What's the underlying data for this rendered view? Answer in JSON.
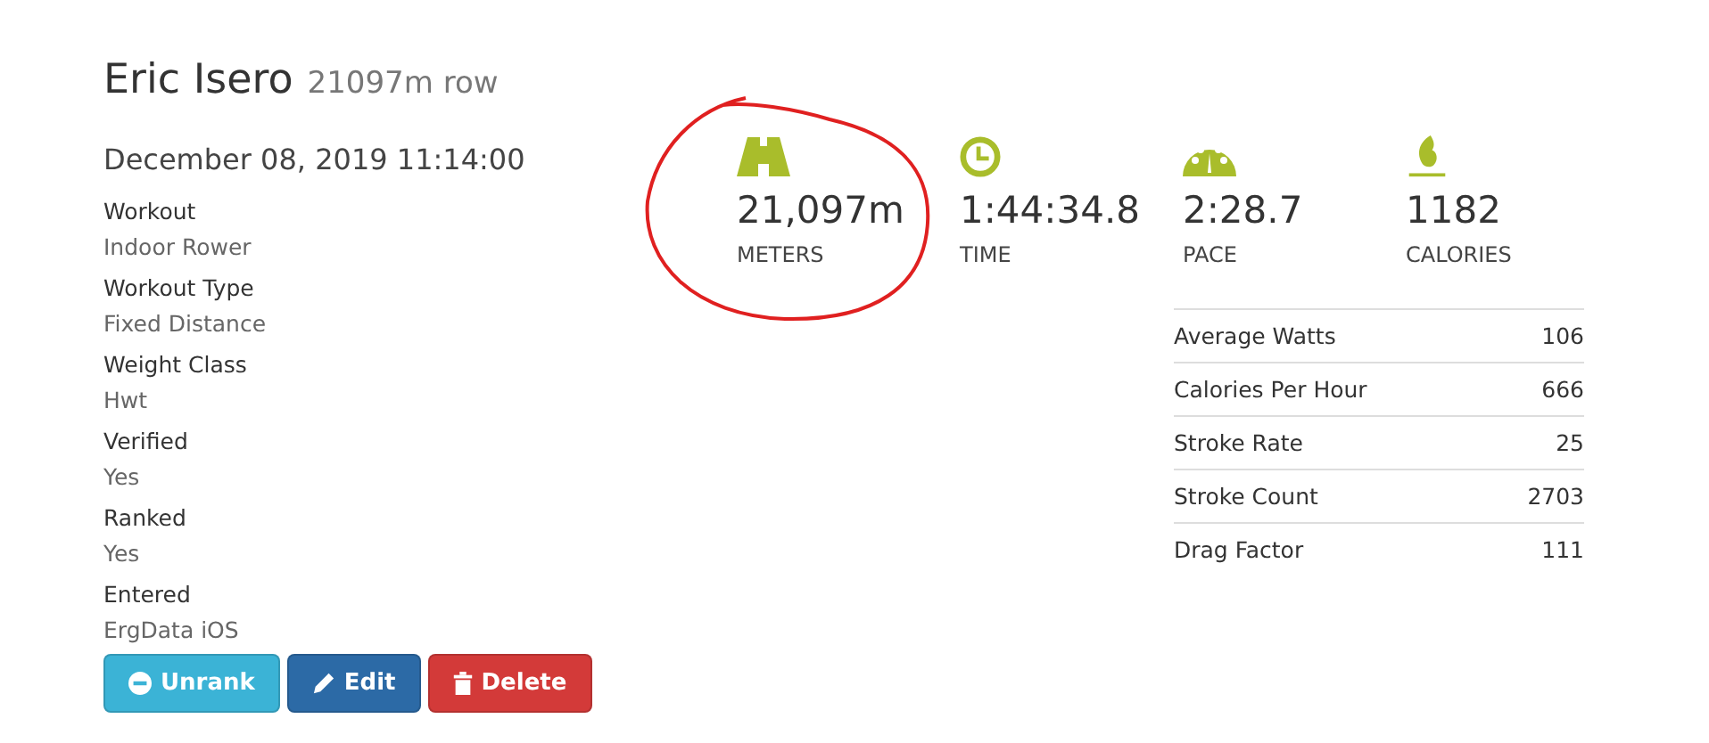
{
  "header": {
    "name": "Eric Isero",
    "subtitle": "21097m row"
  },
  "date": "December 08, 2019 11:14:00",
  "details": [
    {
      "label": "Workout",
      "value": "Indoor Rower"
    },
    {
      "label": "Workout Type",
      "value": "Fixed Distance"
    },
    {
      "label": "Weight Class",
      "value": "Hwt"
    },
    {
      "label": "Verified",
      "value": "Yes"
    },
    {
      "label": "Ranked",
      "value": "Yes"
    },
    {
      "label": "Entered",
      "value": "ErgData iOS"
    }
  ],
  "buttons": [
    {
      "kind": "unrank",
      "label": "Unrank"
    },
    {
      "kind": "edit",
      "label": "Edit"
    },
    {
      "kind": "delete",
      "label": "Delete"
    }
  ],
  "stats": [
    {
      "kind": "distance",
      "value": "21,097m",
      "label": "METERS",
      "circled": true
    },
    {
      "kind": "time",
      "value": "1:44:34.8",
      "label": "TIME",
      "circled": false
    },
    {
      "kind": "pace",
      "value": "2:28.7",
      "label": "PACE",
      "circled": false
    },
    {
      "kind": "calories",
      "value": "1182",
      "label": "CALORIES",
      "circled": false
    }
  ],
  "metrics": [
    {
      "label": "Average Watts",
      "value": "106"
    },
    {
      "label": "Calories Per Hour",
      "value": "666"
    },
    {
      "label": "Stroke Rate",
      "value": "25"
    },
    {
      "label": "Stroke Count",
      "value": "2703"
    },
    {
      "label": "Drag Factor",
      "value": "111"
    }
  ]
}
